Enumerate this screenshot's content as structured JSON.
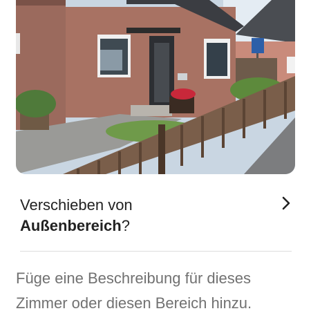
{
  "photo": {
    "subject": "house-exterior"
  },
  "move_prompt": {
    "prefix": "Verschieben von",
    "room": "Außenbereich",
    "suffix": "?",
    "icon": "chevron-right-icon"
  },
  "description_prompt": {
    "text": "Füge eine Beschreibung für dieses Zimmer oder diesen Bereich hinzu."
  }
}
